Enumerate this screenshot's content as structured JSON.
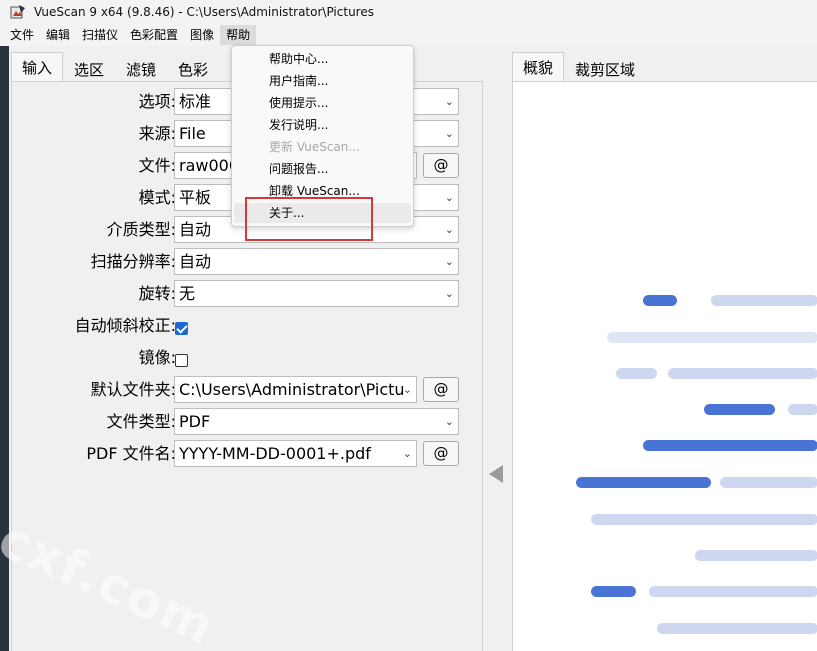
{
  "window": {
    "title": "VueScan 9 x64 (9.8.46) - C:\\Users\\Administrator\\Pictures",
    "icon": "vuescan-app-icon"
  },
  "menubar": {
    "items": [
      "文件",
      "编辑",
      "扫描仪",
      "色彩配置",
      "图像",
      "帮助"
    ],
    "active_index": 5
  },
  "left_tabs": [
    "输入",
    "选区",
    "滤镜",
    "色彩"
  ],
  "right_tabs": [
    "概貌",
    "裁剪区域"
  ],
  "form": {
    "option": {
      "label": "选项:",
      "value": "标准"
    },
    "source": {
      "label": "来源:",
      "value": "File"
    },
    "file": {
      "label": "文件:",
      "value": "raw000",
      "button": "@"
    },
    "mode": {
      "label": "模式:",
      "value": "平板"
    },
    "media": {
      "label": "介质类型:",
      "value": "自动"
    },
    "resolution": {
      "label": "扫描分辨率:",
      "value": "自动"
    },
    "rotation": {
      "label": "旋转:",
      "value": "无"
    },
    "auto_deskew": {
      "label": "自动倾斜校正:",
      "checked": true
    },
    "mirror": {
      "label": "镜像:",
      "checked": false
    },
    "default_folder": {
      "label": "默认文件夹:",
      "value": "C:\\Users\\Administrator\\Pictu",
      "button": "@"
    },
    "file_type": {
      "label": "文件类型:",
      "value": "PDF"
    },
    "pdf_name": {
      "label": "PDF 文件名:",
      "value": "YYYY-MM-DD-0001+.pdf",
      "button": "@"
    }
  },
  "help_menu": {
    "items": [
      {
        "label": "帮助中心...",
        "disabled": false
      },
      {
        "label": "用户指南...",
        "disabled": false
      },
      {
        "label": "使用提示...",
        "disabled": false
      },
      {
        "label": "发行说明...",
        "disabled": false
      },
      {
        "label": "更新 VueScan...",
        "disabled": true
      },
      {
        "label": "问题报告...",
        "disabled": false
      },
      {
        "label": "卸载 VueScan...",
        "disabled": false
      },
      {
        "label": "关于...",
        "disabled": false,
        "highlighted": true
      }
    ]
  },
  "watermark": "cxf.com",
  "colors": {
    "preview_bar_dark": "#4a73d6",
    "preview_bar_light": "#cdd7f0",
    "highlight_box": "#d23a3a",
    "checkbox_on": "#1e66d0"
  }
}
